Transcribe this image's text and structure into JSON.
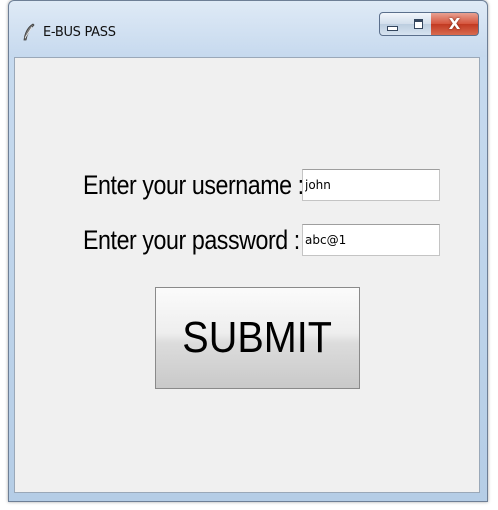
{
  "window": {
    "title": "E-BUS PASS",
    "icon": "feather-icon",
    "controls": {
      "minimize_icon": "minimize-icon",
      "maximize_icon": "maximize-icon",
      "close_label": "X"
    }
  },
  "form": {
    "username_label": "Enter your username :",
    "username_value": "john",
    "password_label": "Enter your password :",
    "password_value": "abc@1",
    "submit_label": "SUBMIT"
  },
  "colors": {
    "titlebar": "#c6d9ee",
    "client_background": "#f0f0f0",
    "close_button": "#c23a22"
  }
}
